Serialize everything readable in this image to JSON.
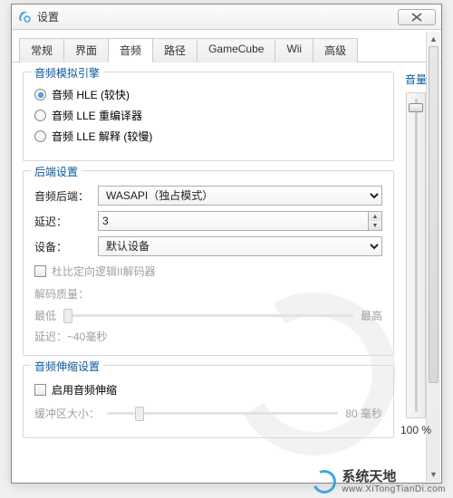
{
  "window": {
    "title": "设置"
  },
  "tabs": [
    "常规",
    "界面",
    "音频",
    "路径",
    "GameCube",
    "Wii",
    "高级"
  ],
  "tabs_active_index": 2,
  "engine": {
    "title": "音频模拟引擎",
    "options": [
      "音频 HLE (较快)",
      "音频 LLE 重编译器",
      "音频 LLE 解释 (较慢)"
    ],
    "selected_index": 0
  },
  "volume": {
    "label": "音量",
    "percent_text": "100 %",
    "thumb_pos": 0.03
  },
  "backend": {
    "title": "后端设置",
    "backend_label": "音频后端：",
    "backend_value": "WASAPI（独占模式）",
    "latency_label": "延迟：",
    "latency_value": "3",
    "device_label": "设备：",
    "device_value": "默认设备",
    "dolby_label": "杜比定向逻辑II解码器",
    "quality_label": "解码质量：",
    "quality_low": "最低",
    "quality_high": "最高",
    "latency_note": "延迟：~40毫秒"
  },
  "stretch": {
    "title": "音频伸缩设置",
    "enable_label": "启用音频伸缩",
    "buffer_label": "缓冲区大小：",
    "buffer_value_text": "80 毫秒"
  },
  "watermark": {
    "line1": "系统天地",
    "line2": "www.XiTongTianDi.com"
  }
}
